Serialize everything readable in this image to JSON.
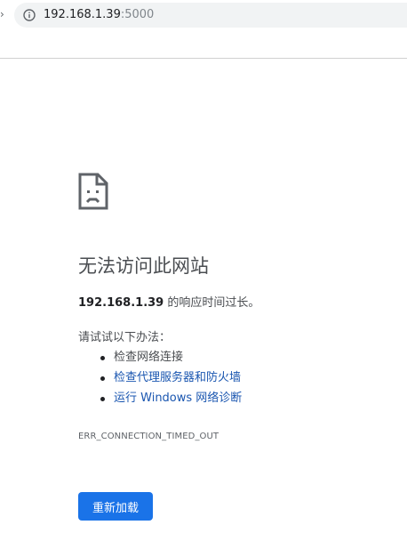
{
  "browser": {
    "url_host": "192.168.1.39",
    "url_port": ":5000"
  },
  "error_page": {
    "icon": "sad-page-icon",
    "heading": "无法访问此网站",
    "host": "192.168.1.39",
    "summary_suffix": " 的响应时间过长。",
    "try_label": "请试试以下办法：",
    "suggestions": [
      {
        "label": "检查网络连接",
        "is_link": false
      },
      {
        "label": "检查代理服务器和防火墙",
        "is_link": true
      },
      {
        "label": "运行 Windows 网络诊断",
        "is_link": true
      }
    ],
    "error_code": "ERR_CONNECTION_TIMED_OUT",
    "reload_label": "重新加载"
  },
  "colors": {
    "button_blue": "#1a73e8",
    "link_blue": "#1a56b0",
    "text_gray": "#4a4d51",
    "omnibox_bg": "#f1f3f4"
  }
}
